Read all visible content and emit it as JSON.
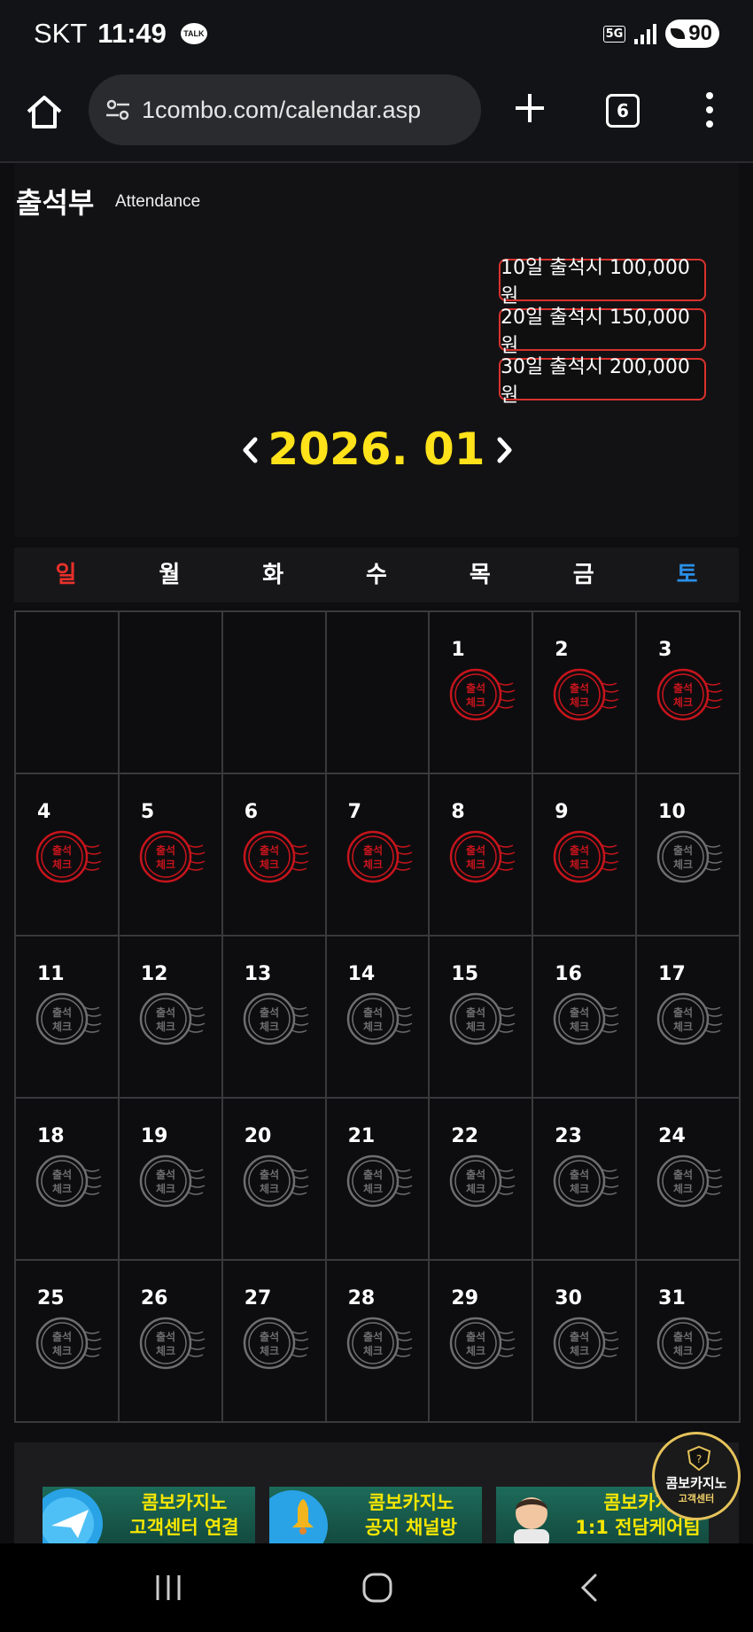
{
  "status_bar": {
    "carrier": "SKT",
    "time": "11:49",
    "talk_icon": "TALK",
    "network": "5G",
    "battery": "90"
  },
  "browser": {
    "url": "1combo.com/calendar.asp",
    "tab_count": "6"
  },
  "page": {
    "title": "출석부",
    "subtitle": "Attendance"
  },
  "rewards": [
    {
      "label": "10일 출석시 100,000원"
    },
    {
      "label": "20일 출석시 150,000원"
    },
    {
      "label": "30일 출석시 200,000원"
    }
  ],
  "calendar": {
    "month_label": "2026. 01",
    "weekdays": [
      "일",
      "월",
      "화",
      "수",
      "목",
      "금",
      "토"
    ],
    "weekday_colors": {
      "sunday": "#e8302a",
      "saturday": "#2a8fe8",
      "default": "#ffffff"
    },
    "leading_blank_cells": 4,
    "days": [
      {
        "day": "1",
        "checked": true
      },
      {
        "day": "2",
        "checked": true
      },
      {
        "day": "3",
        "checked": true
      },
      {
        "day": "4",
        "checked": true
      },
      {
        "day": "5",
        "checked": true
      },
      {
        "day": "6",
        "checked": true
      },
      {
        "day": "7",
        "checked": true
      },
      {
        "day": "8",
        "checked": true
      },
      {
        "day": "9",
        "checked": true
      },
      {
        "day": "10",
        "checked": false
      },
      {
        "day": "11",
        "checked": false
      },
      {
        "day": "12",
        "checked": false
      },
      {
        "day": "13",
        "checked": false
      },
      {
        "day": "14",
        "checked": false
      },
      {
        "day": "15",
        "checked": false
      },
      {
        "day": "16",
        "checked": false
      },
      {
        "day": "17",
        "checked": false
      },
      {
        "day": "18",
        "checked": false
      },
      {
        "day": "19",
        "checked": false
      },
      {
        "day": "20",
        "checked": false
      },
      {
        "day": "21",
        "checked": false
      },
      {
        "day": "22",
        "checked": false
      },
      {
        "day": "23",
        "checked": false
      },
      {
        "day": "24",
        "checked": false
      },
      {
        "day": "25",
        "checked": false
      },
      {
        "day": "26",
        "checked": false
      },
      {
        "day": "27",
        "checked": false
      },
      {
        "day": "28",
        "checked": false
      },
      {
        "day": "29",
        "checked": false
      },
      {
        "day": "30",
        "checked": false
      },
      {
        "day": "31",
        "checked": false
      }
    ],
    "stamp_text": [
      "출석",
      "체크"
    ],
    "stamp_colors": {
      "checked": "#c8141c",
      "unchecked": "#6e6e70"
    }
  },
  "banners": [
    {
      "line1": "콤보카지노",
      "line2": "고객센터 연결",
      "icon": "telegram-icon"
    },
    {
      "line1": "콤보카지노",
      "line2": "공지 채널방",
      "icon": "bell-icon"
    },
    {
      "line1": "콤보카지",
      "line2": "1:1 전담케어팀",
      "icon": "avatar-icon"
    }
  ],
  "support_badge": {
    "line1": "콤보카지노",
    "line2": "고객센터"
  }
}
